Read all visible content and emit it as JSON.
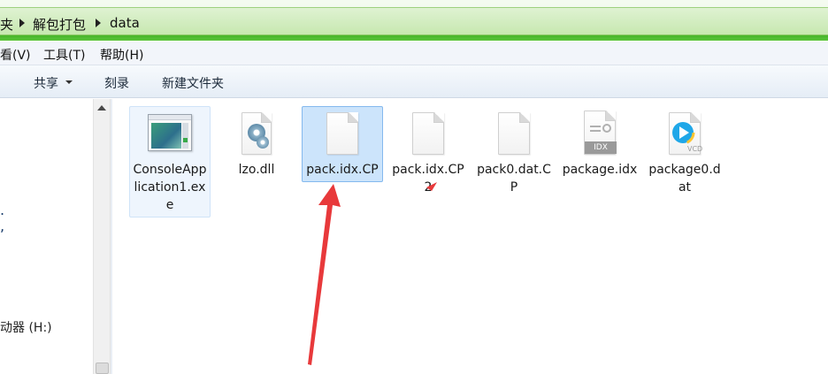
{
  "address": {
    "crumbs": [
      "夹",
      "解包打包",
      "data"
    ]
  },
  "menu": {
    "items": [
      "看(V)",
      "工具(T)",
      "帮助(H)"
    ]
  },
  "toolbar": {
    "share": "共享",
    "burn": "刻录",
    "new_folder": "新建文件夹"
  },
  "nav": {
    "drive_label": "动器 (H:)"
  },
  "files": [
    {
      "name": "ConsoleApplication1.exe",
      "icon": "exe-icon",
      "state": "hover"
    },
    {
      "name": "lzo.dll",
      "icon": "dll-icon",
      "state": "normal"
    },
    {
      "name": "pack.idx.CP",
      "icon": "blank-file-icon",
      "state": "selected"
    },
    {
      "name": "pack.idx.CP2",
      "icon": "blank-file-icon",
      "state": "normal"
    },
    {
      "name": "pack0.dat.CP",
      "icon": "blank-file-icon",
      "state": "normal"
    },
    {
      "name": "package.idx",
      "icon": "idx-file-icon",
      "badge": "IDX",
      "state": "normal"
    },
    {
      "name": "package0.dat",
      "icon": "vcd-file-icon",
      "badge": "VCD",
      "state": "normal"
    }
  ],
  "colors": {
    "address_green": "#c7e8b0",
    "selected_bg": "#cce4fb",
    "annotation_arrow": "#e8393b"
  }
}
